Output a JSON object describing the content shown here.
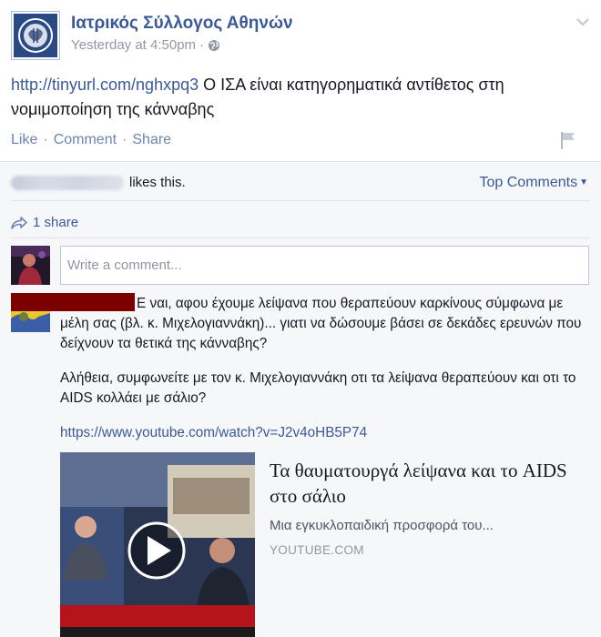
{
  "post": {
    "page_name": "Ιατρικός Σύλλογος Αθηνών",
    "timestamp": "Yesterday at 4:50pm",
    "audience_icon": "globe-icon",
    "link": "http://tinyurl.com/nghxpq3",
    "text": " Ο ΙΣΑ είναι κατηγορηματικά αντίθετος στη νομιμοποίηση της κάνναβης"
  },
  "actions": {
    "like": "Like",
    "comment": "Comment",
    "share": "Share",
    "separator": "·"
  },
  "feedback": {
    "likes_suffix": "likes this.",
    "top_comments": "Top Comments",
    "shares": "1 share",
    "comment_placeholder": "Write a comment..."
  },
  "comment": {
    "paragraph1": "Ε ναι, αφου έχουμε λείψανα που θεραπεύουν καρκίνους σύμφωνα με μέλη σας (βλ. κ. Μιχελογιαννάκη)... γιατι να δώσουμε βάσει σε δεκάδες ερευνών που δείχνουν τα θετικά της κάνναβης?",
    "paragraph2": "Αλήθεια, συμφωνείτε με τον κ. Μιχελογιαννάκη οτι τα λείψανα θεραπεύουν και οτι το AIDS κολλάει με σάλιο?",
    "link": "https://www.youtube.com/watch?v=J2v4oHB5P74"
  },
  "preview": {
    "title": "Τα θαυματουργά λείψανα και το AIDS στο σάλιο",
    "description": "Μια εγκυκλοπαιδική προσφορά του...",
    "source": "YOUTUBE.COM"
  },
  "colors": {
    "link": "#3b5998",
    "muted": "#9197a3",
    "feedback_bg": "#f6f7f9",
    "redaction": "#7d0000"
  }
}
